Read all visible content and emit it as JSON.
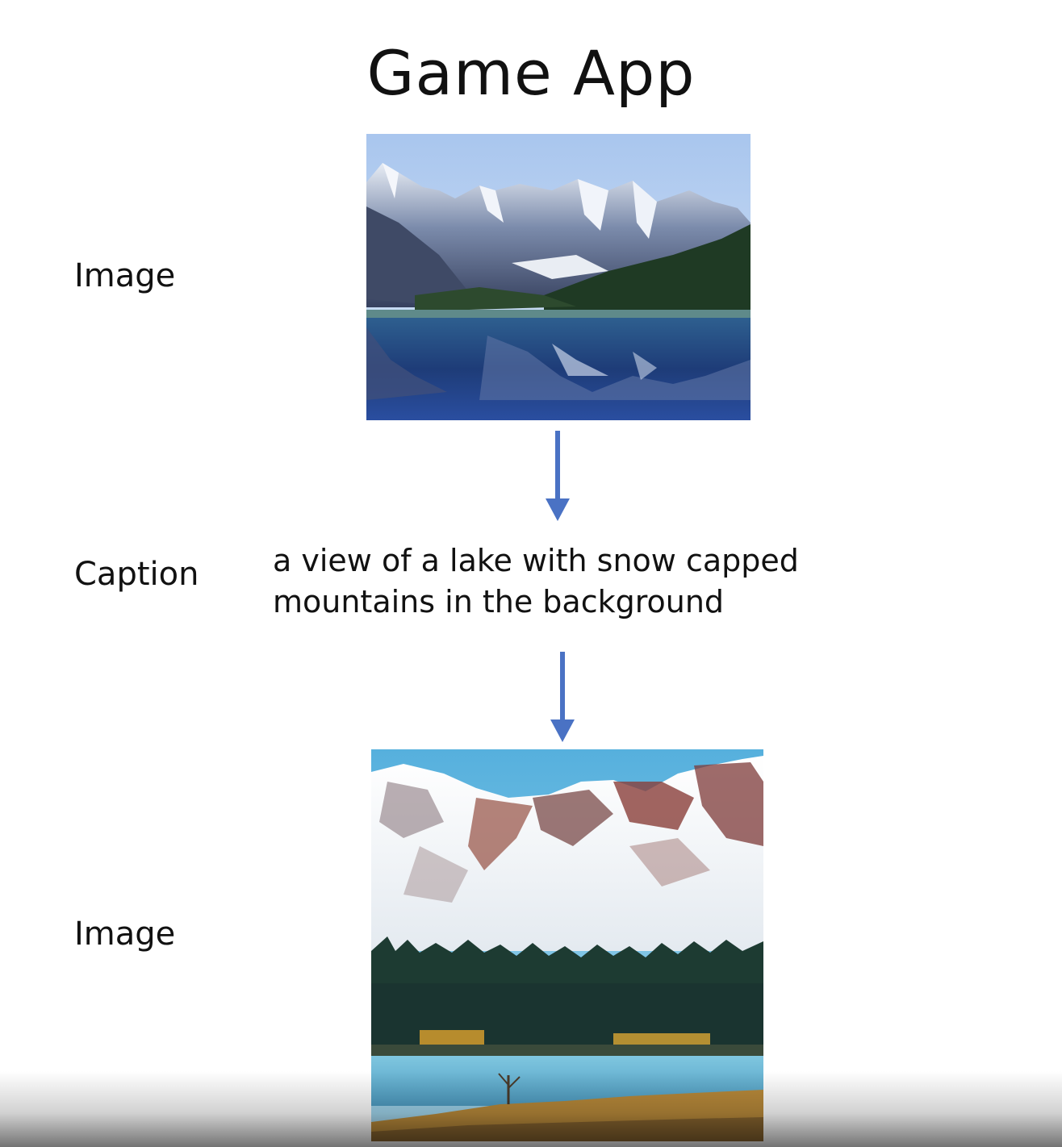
{
  "title": "Game App",
  "labels": {
    "input_image": "Image",
    "caption": "Caption",
    "output_image": "Image"
  },
  "caption_text": "a view of a lake with snow capped mountains in the background",
  "colors": {
    "arrow": "#4a72c4",
    "text": "#111111"
  }
}
